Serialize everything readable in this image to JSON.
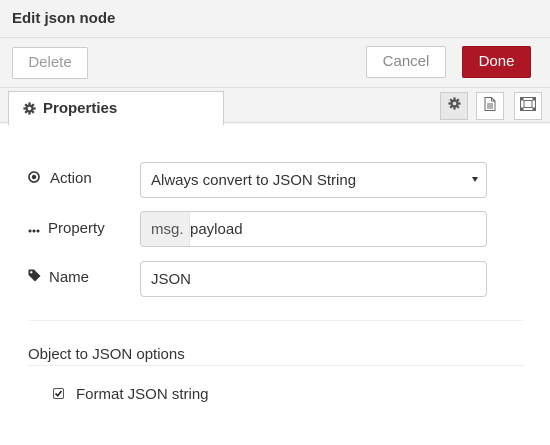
{
  "window": {
    "title": "Edit json node"
  },
  "toolbar": {
    "delete_label": "Delete",
    "cancel_label": "Cancel",
    "done_label": "Done",
    "done_color": "#ad1625"
  },
  "tabs": {
    "properties_label": "Properties"
  },
  "tab_buttons": [
    {
      "icon": "gear-icon",
      "active": true
    },
    {
      "icon": "document-icon",
      "active": false
    },
    {
      "icon": "frame-icon",
      "active": false
    }
  ],
  "form": {
    "action": {
      "label": "Action",
      "value": "Always convert to JSON String"
    },
    "property": {
      "label": "Property",
      "prefix": "msg.",
      "value": "payload"
    },
    "name": {
      "label": "Name",
      "value": "JSON"
    }
  },
  "options": {
    "section_title": "Object to JSON options",
    "format_label": "Format JSON string",
    "format_checked": true
  }
}
